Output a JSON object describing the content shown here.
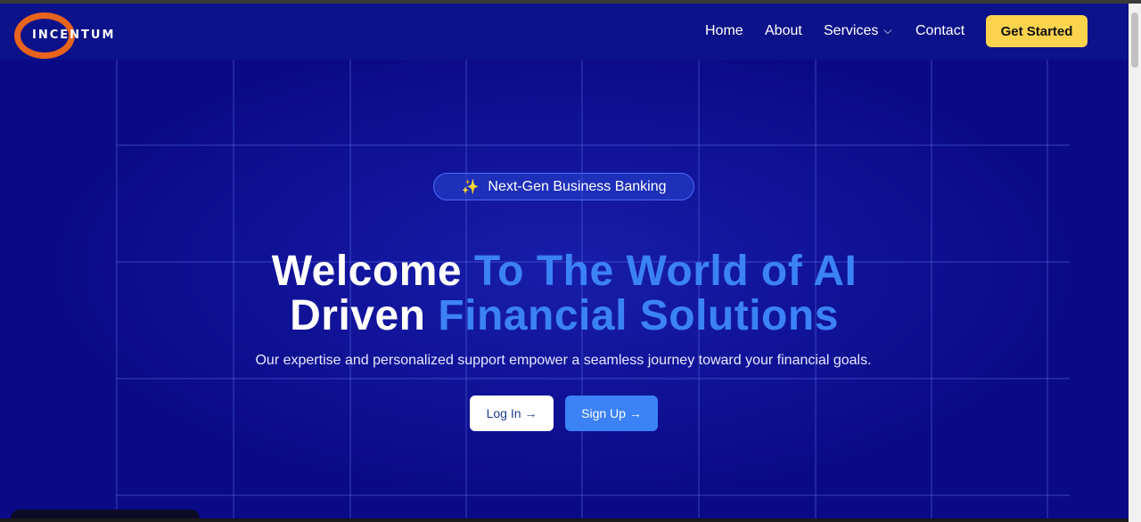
{
  "brand": {
    "name": "INCENTUM"
  },
  "nav": {
    "home": "Home",
    "about": "About",
    "services": "Services",
    "contact": "Contact",
    "cta": "Get Started"
  },
  "hero": {
    "badge": "Next-Gen Business Banking",
    "headline_line1_white": "Welcome",
    "headline_line1_blue": "To The World of AI",
    "headline_line2_white": "Driven",
    "headline_line2_blue": "Financial Solutions",
    "subtitle": "Our expertise and personalized support empower a seamless journey toward your financial goals.",
    "login_label": "Log In →",
    "signup_label": "Sign Up →"
  },
  "icons": {
    "badge_icon": "sparkles-icon",
    "services_dropdown": "chevron-down-icon"
  },
  "colors": {
    "background": "#0a0a86",
    "accent_blue": "#3b82f6",
    "cta_yellow": "#fcd34d",
    "logo_orange": "#e8631c"
  }
}
